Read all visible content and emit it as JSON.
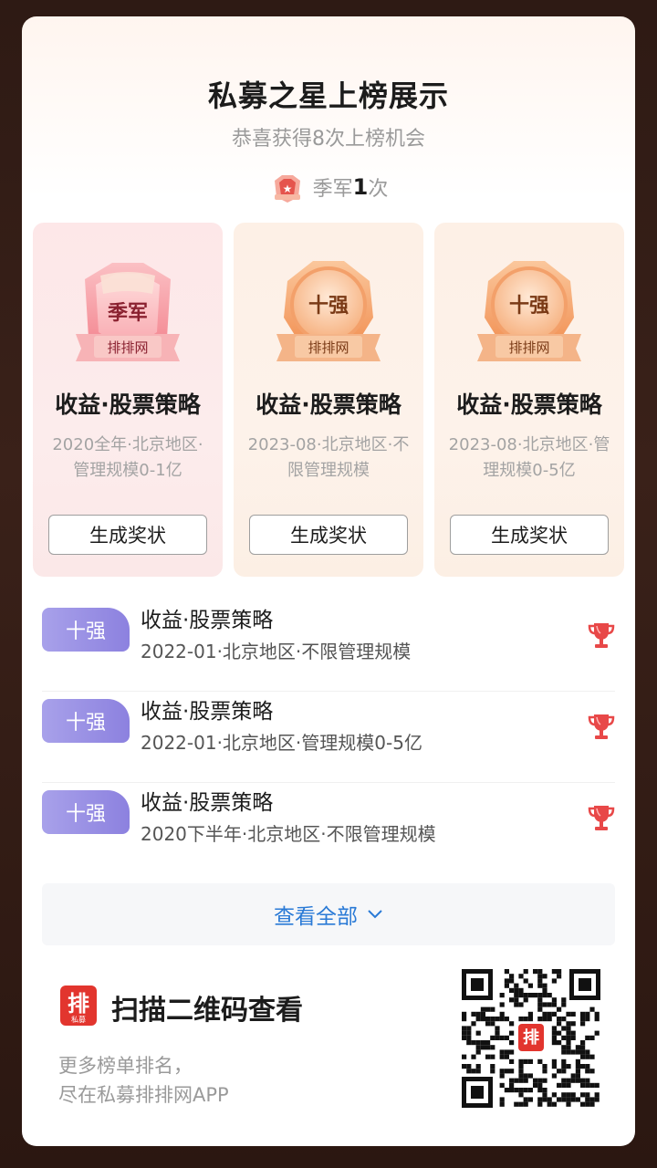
{
  "header": {
    "title": "私募之星上榜展示",
    "subtitle": "恭喜获得8次上榜机会",
    "season_prefix": "季军",
    "season_count": "1",
    "season_suffix": "次"
  },
  "badges": [
    {
      "rank": "季军",
      "brand": "排排网",
      "title": "收益·股票策略",
      "desc": "2020全年·北京地区·管理规模0-1亿",
      "button": "生成奖状",
      "theme": "#f7a0a7"
    },
    {
      "rank": "十强",
      "brand": "排排网",
      "title": "收益·股票策略",
      "desc": "2023-08·北京地区·不限管理规模",
      "button": "生成奖状",
      "theme": "#f4a66f"
    },
    {
      "rank": "十强",
      "brand": "排排网",
      "title": "收益·股票策略",
      "desc": "2023-08·北京地区·管理规模0-5亿",
      "button": "生成奖状",
      "theme": "#f4a66f"
    }
  ],
  "list": [
    {
      "tag": "十强",
      "title": "收益·股票策略",
      "desc": "2022-01·北京地区·不限管理规模",
      "icon": "trophy-icon"
    },
    {
      "tag": "十强",
      "title": "收益·股票策略",
      "desc": "2022-01·北京地区·管理规模0-5亿",
      "icon": "trophy-icon"
    },
    {
      "tag": "十强",
      "title": "收益·股票策略",
      "desc": "2020下半年·北京地区·不限管理规模",
      "icon": "trophy-icon"
    }
  ],
  "view_all": "查看全部",
  "footer": {
    "logo_text": "排",
    "logo_sub": "私募",
    "title": "扫描二维码查看",
    "desc_line1": "更多榜单排名，",
    "desc_line2": "尽在私募排排网APP"
  },
  "colors": {
    "accent_blue": "#2a7ad6",
    "tag_purple": "#9a90e4",
    "medal_red": "#f0707c",
    "medal_orange": "#f08a4b",
    "trophy_red": "#e84848"
  }
}
